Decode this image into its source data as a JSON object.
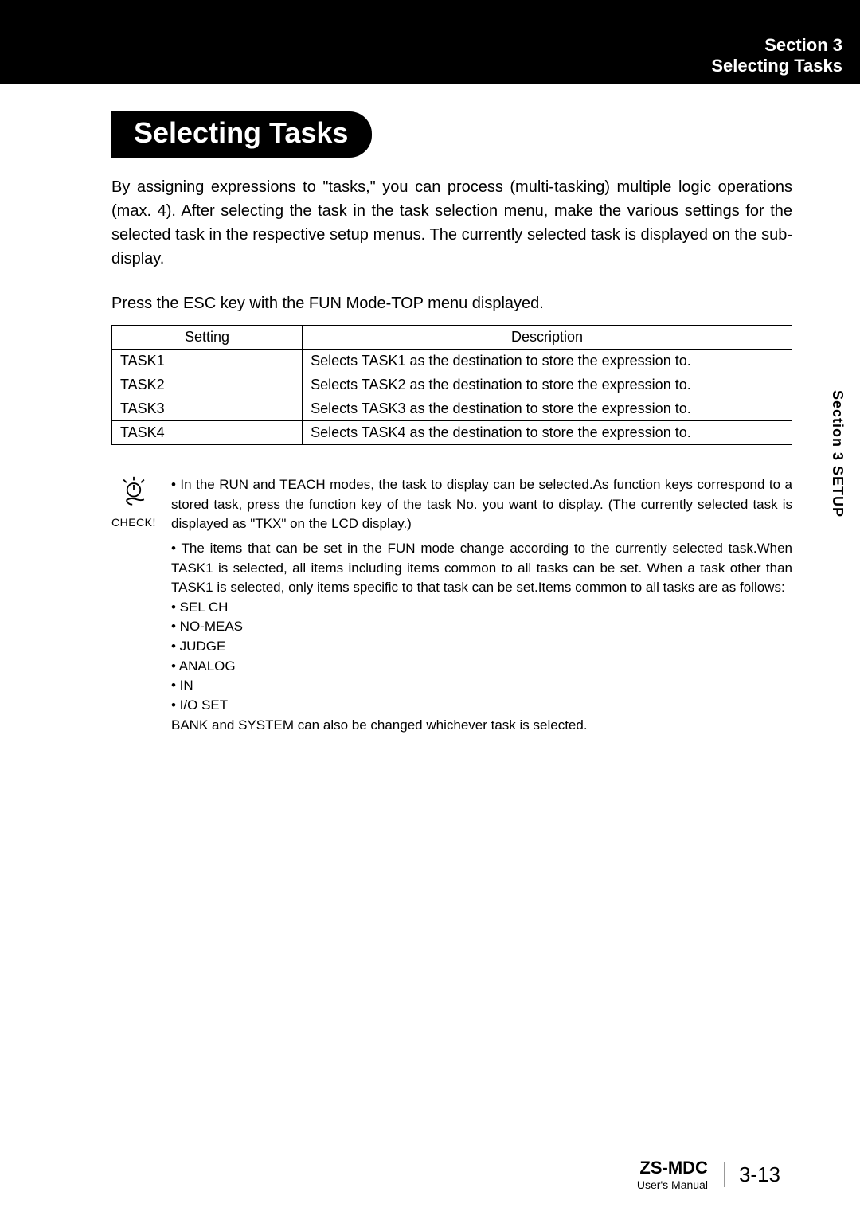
{
  "header": {
    "section_line": "Section 3",
    "title_line": "Selecting Tasks"
  },
  "side_tab": "Section 3   SETUP",
  "ribbon_heading": "Selecting Tasks",
  "intro_paragraph": "By assigning expressions to \"tasks,\" you can process (multi-tasking) multiple logic operations (max. 4). After selecting the task in the task selection menu, make the various settings for the selected task in the respective setup menus. The currently selected task is displayed on the sub-display.",
  "instruction_line": "Press the ESC key with the FUN Mode-TOP menu displayed.",
  "table": {
    "head": {
      "c1": "Setting",
      "c2": "Description"
    },
    "rows": [
      {
        "c1": "TASK1",
        "c2": "Selects TASK1 as the destination to store the expression to."
      },
      {
        "c1": "TASK2",
        "c2": "Selects TASK2 as the destination to store the expression to."
      },
      {
        "c1": "TASK3",
        "c2": "Selects TASK3 as the destination to store the expression to."
      },
      {
        "c1": "TASK4",
        "c2": "Selects TASK4 as the destination to store the expression to."
      }
    ]
  },
  "note": {
    "icon_label": "CHECK!",
    "bullet1": "• In the RUN and TEACH modes, the task to display can be selected.As function keys correspond to a stored task, press the function key of the task No. you want to display. (The currently selected task is displayed as \"TKX\" on the LCD display.)",
    "bullet2": "• The items that can be set in the FUN mode change according to the currently selected task.When TASK1 is selected, all items including items common to all tasks can be set. When a task other than TASK1 is selected, only items specific to that task can be set.Items common to all tasks are as follows:",
    "items": [
      "• SEL CH",
      "• NO-MEAS",
      "• JUDGE",
      "• ANALOG",
      "• IN",
      "• I/O SET"
    ],
    "tail": "BANK and SYSTEM can also be changed whichever task is selected."
  },
  "footer": {
    "product": "ZS-MDC",
    "subtitle": "User's Manual",
    "page": "3-13"
  }
}
